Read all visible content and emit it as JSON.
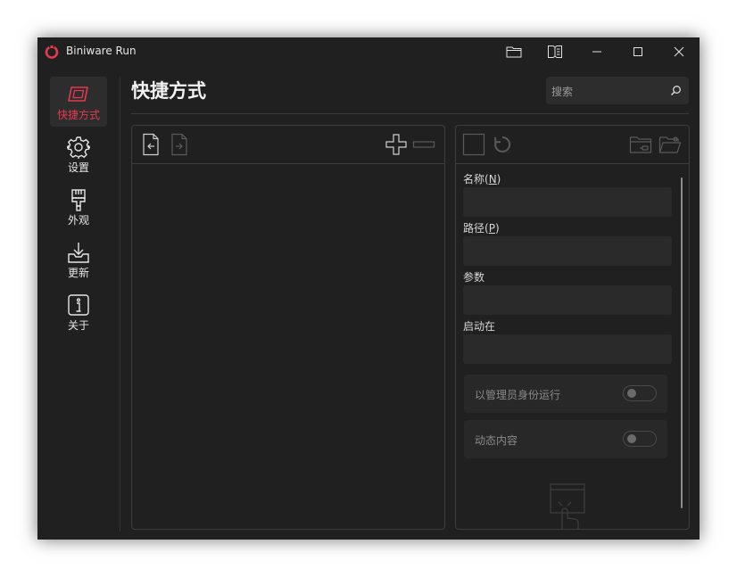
{
  "app": {
    "title": "Biniware Run"
  },
  "titlebar": {
    "buttons": [
      "folder-icon",
      "book-icon",
      "minimize-icon",
      "maximize-icon",
      "close-icon"
    ]
  },
  "sidebar": {
    "items": [
      {
        "label": "快捷方式",
        "icon": "shortcut-icon",
        "active": true
      },
      {
        "label": "设置",
        "icon": "gear-icon",
        "active": false
      },
      {
        "label": "外观",
        "icon": "brush-icon",
        "active": false
      },
      {
        "label": "更新",
        "icon": "download-icon",
        "active": false
      },
      {
        "label": "关于",
        "icon": "info-icon",
        "active": false
      }
    ]
  },
  "header": {
    "title": "快捷方式",
    "search_placeholder": "搜索"
  },
  "list_panel": {
    "tools": [
      "import-icon",
      "export-icon",
      "add-icon",
      "remove-icon"
    ]
  },
  "detail_panel": {
    "tools": [
      "stop-icon",
      "refresh-icon",
      "folder-link-icon",
      "folder-open-icon"
    ],
    "fields": [
      {
        "label": "名称(",
        "accel": "N",
        "suffix": ")",
        "value": ""
      },
      {
        "label": "路径(",
        "accel": "P",
        "suffix": ")",
        "value": ""
      },
      {
        "label": "参数",
        "accel": "",
        "suffix": "",
        "value": ""
      },
      {
        "label": "启动在",
        "accel": "",
        "suffix": "",
        "value": ""
      }
    ],
    "toggles": [
      {
        "label": "以管理员身份运行",
        "on": false
      },
      {
        "label": "动态内容",
        "on": false
      }
    ]
  },
  "colors": {
    "accent": "#e53a4f",
    "background": "#202020",
    "panel_border": "#3d3d3d"
  }
}
